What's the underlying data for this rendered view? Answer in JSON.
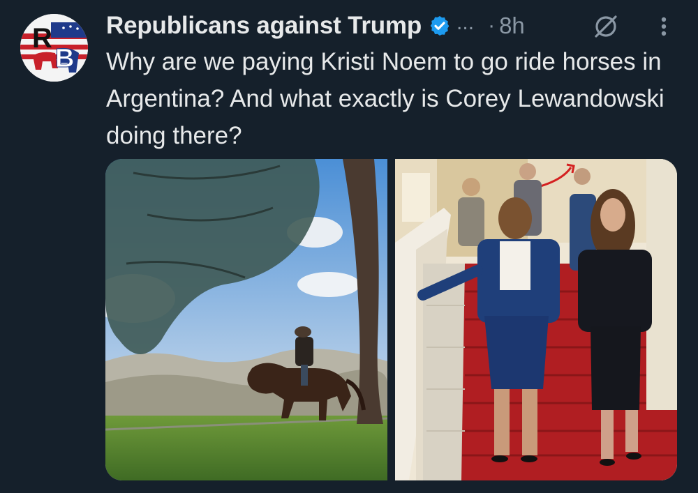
{
  "tweet": {
    "author_name": "Republicans against Trump",
    "avatar_initials": "RB",
    "more_label": "...",
    "separator": "·",
    "time": "8h",
    "text": "Why are we paying Kristi Noem to go ride horses in Argentina? And what exactly is Corey Lewandowski doing there?"
  },
  "icons": {
    "verified": "verified-badge-icon",
    "grok": "grok-icon",
    "more": "more-vertical-icon"
  },
  "colors": {
    "background": "#15202b",
    "text": "#e7e9ea",
    "secondary_text": "#8b98a5",
    "verified_blue": "#1d9bf0",
    "carpet_red": "#b01e22"
  }
}
